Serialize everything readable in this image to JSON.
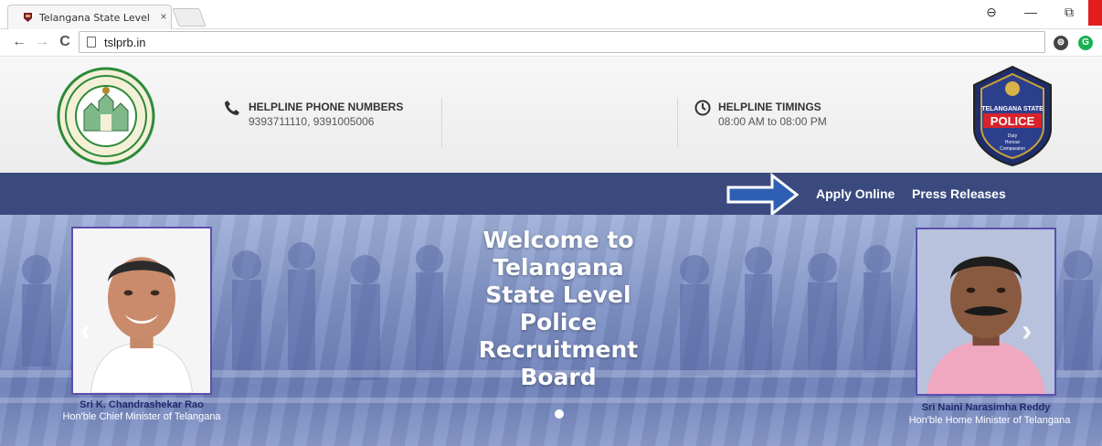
{
  "browser": {
    "tab_title": "Telangana State Level Po",
    "tab_close": "×",
    "url": "tslprb.in",
    "back": "←",
    "forward": "→",
    "reload": "C",
    "window_controls": {
      "account": "⊖",
      "minimize": "—",
      "restore": "⧉"
    },
    "extensions": [
      {
        "label": "⊜",
        "color": "#444444"
      },
      {
        "label": "G",
        "color": "#19b152"
      }
    ]
  },
  "header": {
    "helpline_phone": {
      "title": "HELPLINE PHONE NUMBERS",
      "value": "9393711110, 9391005006",
      "icon": "phone-icon"
    },
    "helpline_timings": {
      "title": "HELPLINE TIMINGS",
      "value": "08:00 AM to 08:00 PM",
      "icon": "clock-icon"
    },
    "left_logo": "government-of-telangana-emblem",
    "right_logo": {
      "line1": "TELANGANA STATE",
      "line2": "POLICE",
      "line3": "Duty",
      "line4": "Honour",
      "line5": "Compassion"
    }
  },
  "nav": {
    "links": [
      "Apply Online",
      "Press Releases"
    ],
    "bar_color": "#3b4a7e"
  },
  "hero": {
    "welcome_lines": [
      "Welcome to",
      "Telangana",
      "State Level",
      "Police",
      "Recruitment",
      "Board"
    ],
    "left_person": {
      "name": "Sri K. Chandrashekar Rao",
      "role": "Hon'ble Chief Minister of Telangana"
    },
    "right_person": {
      "name": "Sri Naini Narasimha Reddy",
      "role": "Hon'ble Home Minister of Telangana"
    },
    "prev_arrow": "‹",
    "next_arrow": "›"
  }
}
